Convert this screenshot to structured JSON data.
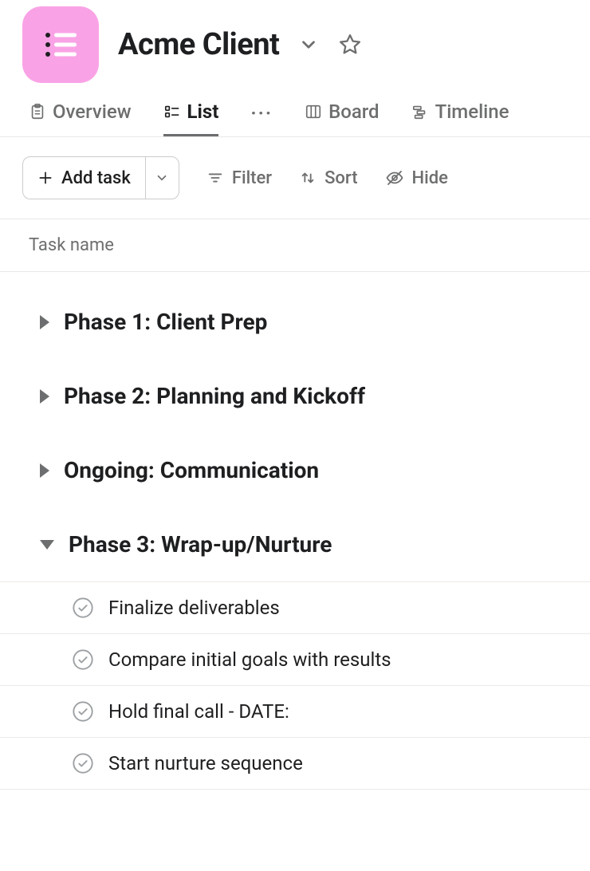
{
  "project": {
    "title": "Acme Client"
  },
  "tabs": {
    "overview": "Overview",
    "list": "List",
    "board": "Board",
    "timeline": "Timeline"
  },
  "toolbar": {
    "add_task": "Add task",
    "filter": "Filter",
    "sort": "Sort",
    "hide": "Hide"
  },
  "columns": {
    "task_name": "Task name"
  },
  "sections": [
    {
      "title": "Phase 1: Client Prep",
      "expanded": false,
      "tasks": []
    },
    {
      "title": "Phase 2: Planning and Kickoff",
      "expanded": false,
      "tasks": []
    },
    {
      "title": "Ongoing: Communication",
      "expanded": false,
      "tasks": []
    },
    {
      "title": "Phase 3: Wrap-up/Nurture",
      "expanded": true,
      "tasks": [
        {
          "name": "Finalize deliverables"
        },
        {
          "name": "Compare initial goals with results"
        },
        {
          "name": "Hold final call - DATE:"
        },
        {
          "name": "Start nurture sequence"
        }
      ]
    }
  ]
}
